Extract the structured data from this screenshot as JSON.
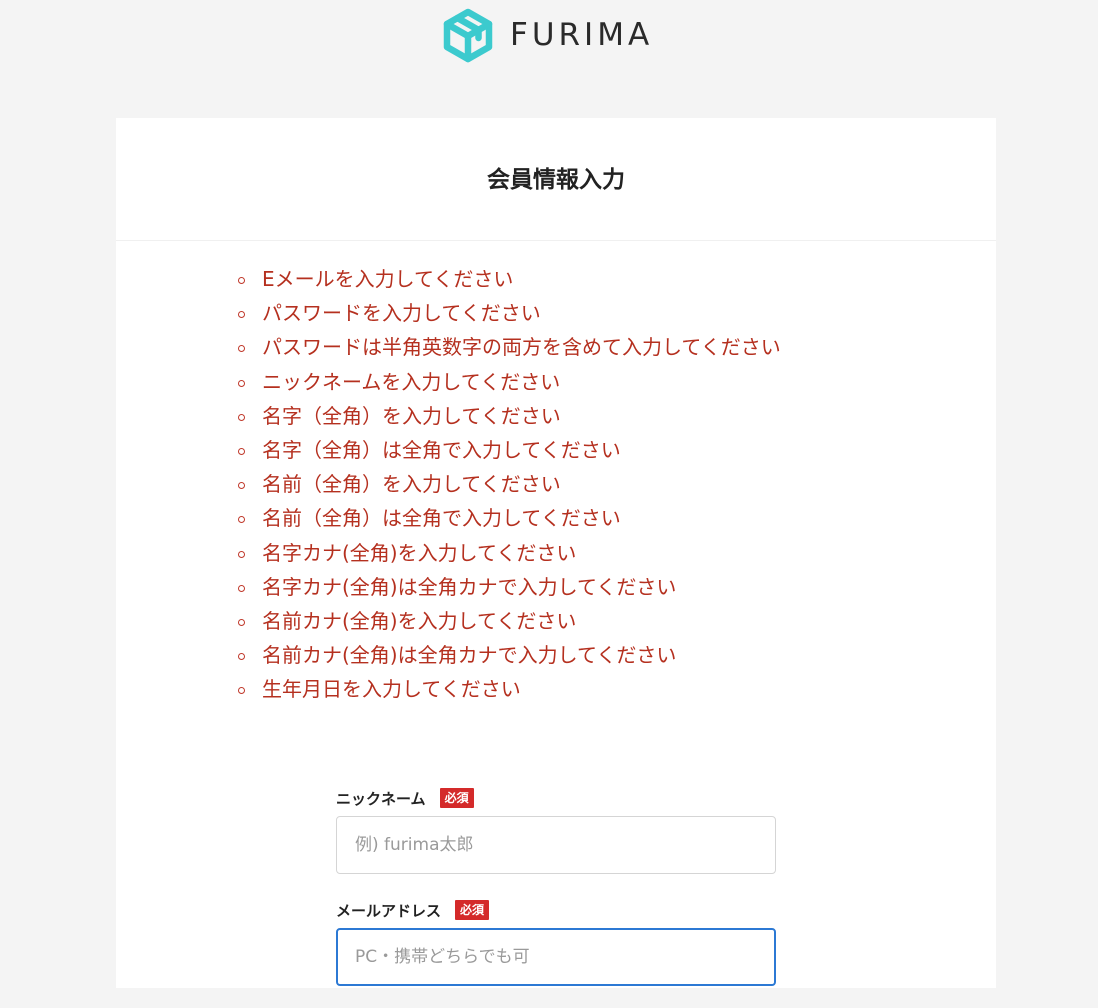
{
  "header": {
    "logo_text": "FURIMA",
    "logo_icon": "box-logo-icon",
    "logo_color": "#3ccace"
  },
  "page": {
    "title": "会員情報入力"
  },
  "errors": [
    "Eメールを入力してください",
    "パスワードを入力してください",
    "パスワードは半角英数字の両方を含めて入力してください",
    "ニックネームを入力してください",
    "名字（全角）を入力してください",
    "名字（全角）は全角で入力してください",
    "名前（全角）を入力してください",
    "名前（全角）は全角で入力してください",
    "名字カナ(全角)を入力してください",
    "名字カナ(全角)は全角カナで入力してください",
    "名前カナ(全角)を入力してください",
    "名前カナ(全角)は全角カナで入力してください",
    "生年月日を入力してください"
  ],
  "form": {
    "nickname": {
      "label": "ニックネーム",
      "required": "必須",
      "placeholder": "例) furima太郎",
      "value": ""
    },
    "email": {
      "label": "メールアドレス",
      "required": "必須",
      "placeholder": "PC・携帯どちらでも可",
      "value": ""
    }
  },
  "colors": {
    "error_text": "#b5301f",
    "required_badge": "#d42a2a",
    "focus_border": "#2c79d4",
    "background": "#f4f4f4"
  }
}
